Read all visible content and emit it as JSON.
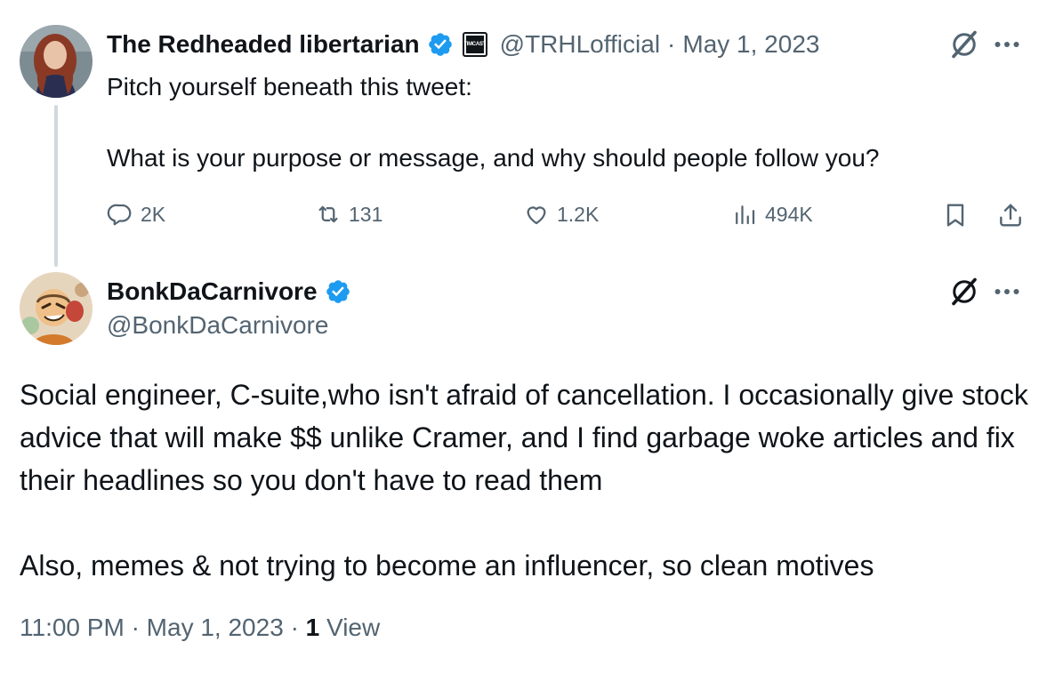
{
  "tweet1": {
    "name": "The Redheaded libertarian",
    "affiliation_badge": "TIMCAST",
    "handle": "@TRHLofficial",
    "separator": "·",
    "date": "May 1, 2023",
    "text": "Pitch yourself beneath this tweet:\n\nWhat is your purpose or message, and why should people follow you?",
    "actions": {
      "replies": "2K",
      "retweets": "131",
      "likes": "1.2K",
      "views": "494K"
    }
  },
  "tweet2": {
    "name": "BonkDaCarnivore",
    "handle": "@BonkDaCarnivore",
    "text": "Social engineer, C-suite,who isn't afraid of cancellation. I occasionally give stock advice that will make $$ unlike Cramer, and I find garbage woke articles and fix their headlines so you don't have to read them\n\nAlso, memes & not trying to become an influencer, so clean motives",
    "time": "11:00 PM",
    "separator": "·",
    "date": "May 1, 2023",
    "view_count": "1",
    "view_label": "View"
  },
  "icons": [
    "verified-badge-icon",
    "grok-icon",
    "more-icon",
    "reply-icon",
    "retweet-icon",
    "like-icon",
    "views-icon",
    "bookmark-icon",
    "share-icon"
  ],
  "colors": {
    "text": "#0f1419",
    "secondary": "#536471",
    "verified": "#1d9bf0",
    "thread_line": "#cfd9de"
  }
}
